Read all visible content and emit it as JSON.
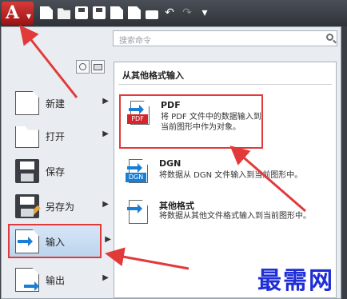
{
  "toolbar": {
    "app_logo": "A",
    "quick_access_icons": [
      "new-icon",
      "open-icon",
      "save-icon",
      "save-as-icon",
      "publish-icon",
      "import-icon",
      "print-icon",
      "undo-icon",
      "redo-icon",
      "customize-icon"
    ]
  },
  "search": {
    "placeholder": "搜索命令"
  },
  "left_menu": {
    "items": [
      {
        "label": "新建",
        "icon": "new-document-icon",
        "has_submenu": true
      },
      {
        "label": "打开",
        "icon": "folder-open-icon",
        "has_submenu": true
      },
      {
        "label": "保存",
        "icon": "save-icon",
        "has_submenu": false
      },
      {
        "label": "另存为",
        "icon": "save-as-icon",
        "has_submenu": true
      },
      {
        "label": "输入",
        "icon": "import-icon",
        "has_submenu": true,
        "selected": true
      },
      {
        "label": "输出",
        "icon": "export-icon",
        "has_submenu": true
      }
    ]
  },
  "submenu": {
    "title": "从其他格式输入",
    "entries": [
      {
        "name": "PDF",
        "tag": "PDF",
        "description": "将 PDF 文件中的数据输入到当前图形中作为对象。"
      },
      {
        "name": "DGN",
        "tag": "DGN",
        "description": "将数据从 DGN 文件输入到当前图形中。"
      },
      {
        "name": "其他格式",
        "tag": "",
        "description": "将数据从其他文件格式输入到当前图形中。"
      }
    ]
  },
  "watermark": "最需网",
  "colors": {
    "highlight": "#e23a3a",
    "accent_blue": "#1a7fd4",
    "pdf_red": "#d7262b"
  }
}
